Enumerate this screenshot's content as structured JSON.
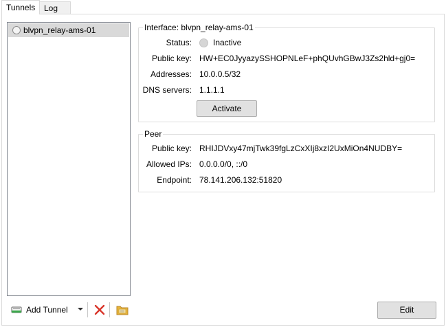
{
  "tabs": [
    {
      "label": "Tunnels",
      "active": true
    },
    {
      "label": "Log",
      "active": false
    }
  ],
  "tunnels": [
    {
      "name": "blvpn_relay-ams-01",
      "selected": true
    }
  ],
  "interface": {
    "title": "Interface: blvpn_relay-ams-01",
    "status_label": "Status:",
    "status_value": "Inactive",
    "public_key_label": "Public key:",
    "public_key_value": "HW+EC0JyyazySSHOPNLeF+phQUvhGBwJ3Zs2hld+gj0=",
    "addresses_label": "Addresses:",
    "addresses_value": "10.0.0.5/32",
    "dns_label": "DNS servers:",
    "dns_value": "1.1.1.1",
    "activate_label": "Activate"
  },
  "peer": {
    "title": "Peer",
    "public_key_label": "Public key:",
    "public_key_value": "RHIJDVxy47mjTwk39fgLzCxXIj8xzI2UxMiOn4NUDBY=",
    "allowed_ips_label": "Allowed IPs:",
    "allowed_ips_value": "0.0.0.0/0, ::/0",
    "endpoint_label": "Endpoint:",
    "endpoint_value": "78.141.206.132:51820"
  },
  "toolbar": {
    "add_tunnel_label": "Add Tunnel",
    "icons": [
      "add-tunnel-icon",
      "dropdown-arrow-icon",
      "delete-icon",
      "export-folder-icon"
    ]
  },
  "edit_label": "Edit",
  "colors": {
    "selection": "#d9d9d9",
    "delete_red": "#d9362b",
    "folder_yellow": "#e8b53a",
    "button_face": "#e1e1e1"
  }
}
